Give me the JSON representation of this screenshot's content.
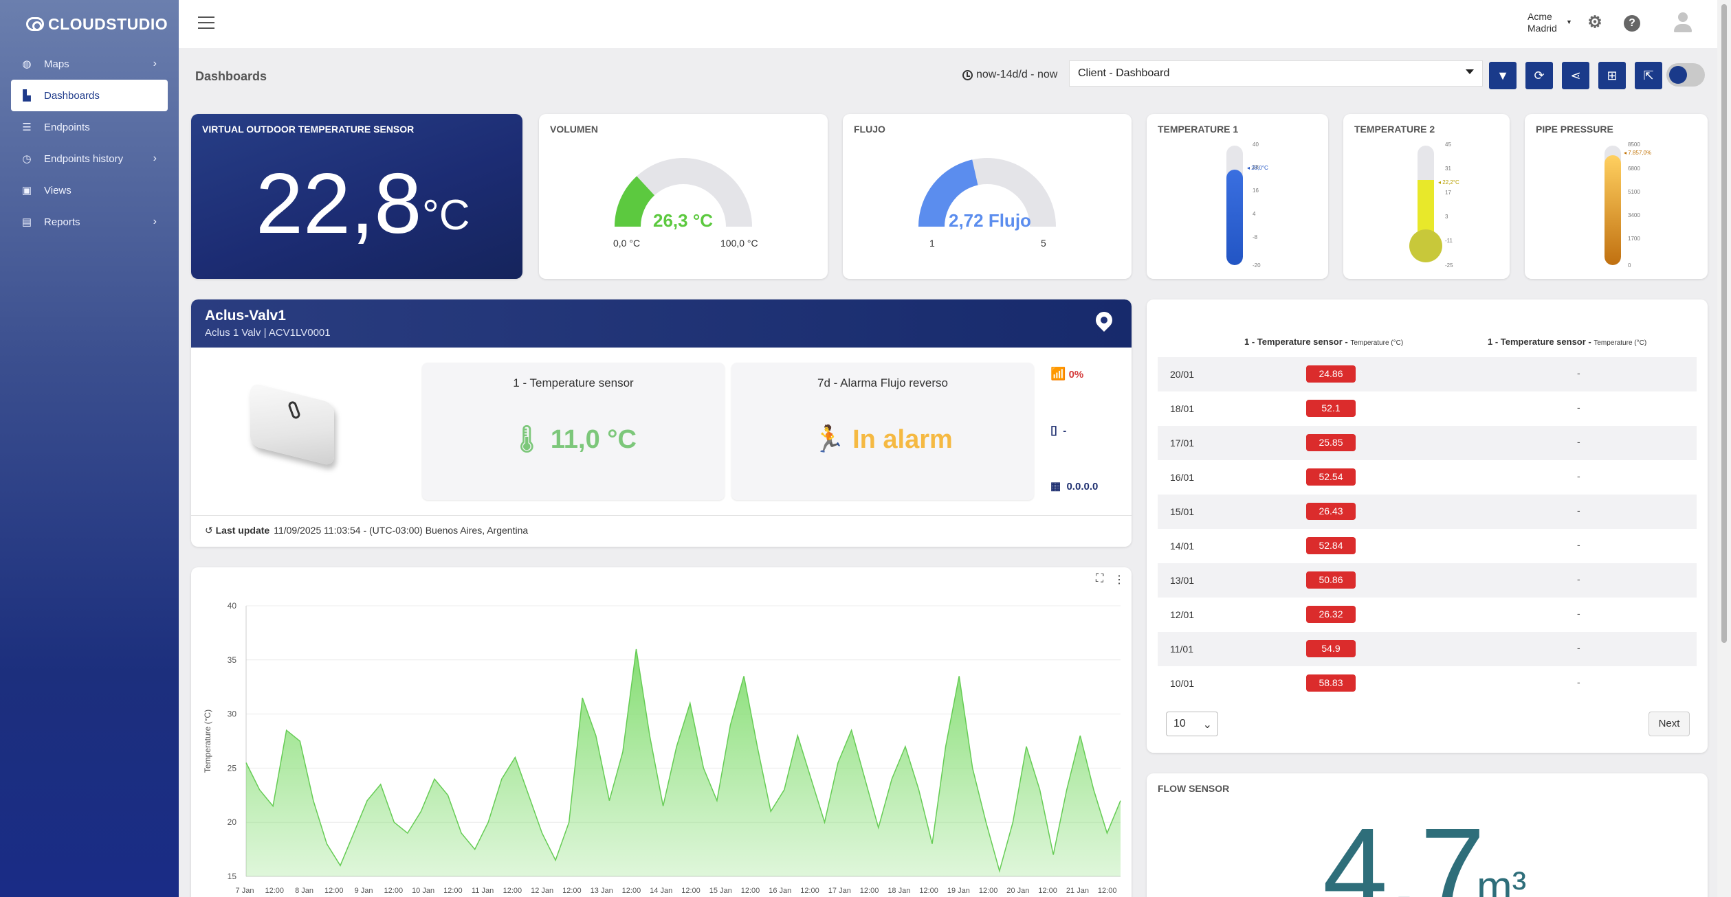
{
  "brand": "CLOUDSTUDIO",
  "sidebar": {
    "items": [
      {
        "label": "Maps",
        "icon": "globe-icon",
        "has_children": true
      },
      {
        "label": "Dashboards",
        "icon": "chart-icon",
        "active": true
      },
      {
        "label": "Endpoints",
        "icon": "list-icon"
      },
      {
        "label": "Endpoints history",
        "icon": "history-icon",
        "has_children": true
      },
      {
        "label": "Views",
        "icon": "image-icon"
      },
      {
        "label": "Reports",
        "icon": "file-icon",
        "has_children": true
      }
    ]
  },
  "topbar": {
    "account": "Acme",
    "location": "Madrid"
  },
  "toolbar": {
    "title": "Dashboards",
    "time_range": "now-14d/d - now",
    "dashboard_select": "Client - Dashboard",
    "accent": "#1a3a8a"
  },
  "widgets": {
    "outdoor": {
      "title": "VIRTUAL OUTDOOR TEMPERATURE SENSOR",
      "value": "22,8",
      "unit": "°C"
    },
    "volumen": {
      "title": "VOLUMEN",
      "value": "26,3 °C",
      "min": "0,0 °C",
      "max": "100,0 °C",
      "fraction": 0.263,
      "color": "#5cc93f"
    },
    "flujo": {
      "title": "FLUJO",
      "value": "2,72 Flujo",
      "min": "1",
      "max": "5",
      "fraction": 0.43,
      "color": "#5b8dee"
    },
    "temp1": {
      "title": "TEMPERATURE 1",
      "value": "28,0°C",
      "ticks": [
        "40",
        "28",
        "16",
        "4",
        "-8",
        "-20"
      ],
      "fraction": 0.8,
      "color": "#2255c4"
    },
    "temp2": {
      "title": "TEMPERATURE 2",
      "value": "22,2°C",
      "ticks": [
        "45",
        "31",
        "17",
        "3",
        "-11",
        "-25"
      ],
      "fraction": 0.67,
      "color": "#e8e82a"
    },
    "pressure": {
      "title": "PIPE PRESSURE",
      "value": "7.857,0%",
      "ticks": [
        "8500",
        "6800",
        "5100",
        "3400",
        "1700",
        "0"
      ],
      "fraction": 0.92,
      "color": "#f0a030"
    }
  },
  "aclus": {
    "name": "Aclus-Valv1",
    "subtitle": "Aclus 1 Valv | ACV1LV0001",
    "sensor_title": "1 - Temperature sensor",
    "sensor_value": "11,0 °C",
    "alarm_title": "7d - Alarma Flujo reverso",
    "alarm_value": "In alarm",
    "signal": "0%",
    "battery": "-",
    "ip": "0.0.0.0",
    "last_update_label": "Last update",
    "last_update": "11/09/2025 11:03:54 - (UTC-03:00) Buenos Aires, Argentina"
  },
  "table": {
    "col1": "1 - Temperature sensor",
    "col1_sub": "Temperature (°C)",
    "col2": "1 - Temperature sensor",
    "col2_sub": "Temperature (°C)",
    "rows": [
      {
        "date": "20/01",
        "v1": "24.86",
        "v2": "-"
      },
      {
        "date": "18/01",
        "v1": "52.1",
        "v2": "-"
      },
      {
        "date": "17/01",
        "v1": "25.85",
        "v2": "-"
      },
      {
        "date": "16/01",
        "v1": "52.54",
        "v2": "-"
      },
      {
        "date": "15/01",
        "v1": "26.43",
        "v2": "-"
      },
      {
        "date": "14/01",
        "v1": "52.84",
        "v2": "-"
      },
      {
        "date": "13/01",
        "v1": "50.86",
        "v2": "-"
      },
      {
        "date": "12/01",
        "v1": "26.32",
        "v2": "-"
      },
      {
        "date": "11/01",
        "v1": "54.9",
        "v2": "-"
      },
      {
        "date": "10/01",
        "v1": "58.83",
        "v2": "-"
      }
    ],
    "page_size": "10",
    "next_label": "Next"
  },
  "flow_sensor": {
    "title": "FLOW SENSOR",
    "value": "4,7",
    "unit": "m³"
  },
  "chart_data": {
    "type": "area",
    "ylabel": "Temperature (°C)",
    "ylim": [
      15,
      40
    ],
    "yticks": [
      "15",
      "20",
      "25",
      "30",
      "35",
      "40"
    ],
    "xticks": [
      "7 Jan",
      "12:00",
      "8 Jan",
      "12:00",
      "9 Jan",
      "12:00",
      "10 Jan",
      "12:00",
      "11 Jan",
      "12:00",
      "12 Jan",
      "12:00",
      "13 Jan",
      "12:00",
      "14 Jan",
      "12:00",
      "15 Jan",
      "12:00",
      "16 Jan",
      "12:00",
      "17 Jan",
      "12:00",
      "18 Jan",
      "12:00",
      "19 Jan",
      "12:00",
      "20 Jan",
      "12:00",
      "21 Jan",
      "12:00"
    ],
    "x_start": "7 Jan 00:00",
    "x_end": "21 Jan 12:00",
    "values": [
      25.5,
      23,
      21.5,
      28.5,
      27.5,
      22,
      18,
      16,
      19,
      22,
      23.5,
      20,
      19,
      21,
      24,
      22.5,
      19,
      17.5,
      20,
      24,
      26,
      22.5,
      19,
      16.5,
      20,
      31.5,
      28,
      22,
      26.5,
      36,
      28,
      21.5,
      27,
      31,
      25,
      22,
      29,
      33.5,
      27,
      21,
      23,
      28,
      24,
      20,
      25.5,
      28.5,
      24,
      19.5,
      24,
      27,
      23,
      18,
      27,
      33.5,
      25,
      20,
      15.5,
      20,
      27,
      23,
      17,
      23,
      28,
      23,
      19,
      22
    ],
    "color": "#7fdc6c"
  }
}
